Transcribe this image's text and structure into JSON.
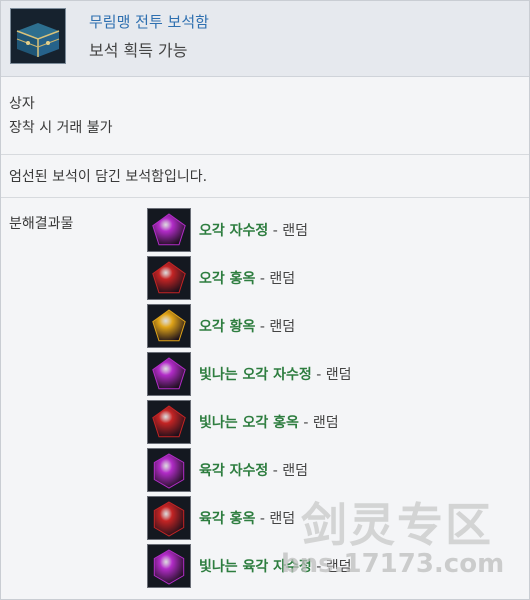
{
  "header": {
    "title": "무림맹 전투 보석함",
    "subtitle": "보석 획득 가능"
  },
  "info": {
    "type": "상자",
    "trade": "장착 시 거래 불가"
  },
  "description": "엄선된 보석이 담긴 보석함입니다.",
  "decomposition": {
    "label": "분해결과물",
    "separator": "-",
    "random_label": "랜덤",
    "items": [
      {
        "name": "오각 자수정",
        "color": "#b22cc8",
        "shape": "pentagon"
      },
      {
        "name": "오각 홍옥",
        "color": "#c42424",
        "shape": "pentagon"
      },
      {
        "name": "오각 황옥",
        "color": "#e0a418",
        "shape": "pentagon"
      },
      {
        "name": "빛나는 오각 자수정",
        "color": "#b22cc8",
        "shape": "pentagon"
      },
      {
        "name": "빛나는 오각 홍옥",
        "color": "#c42424",
        "shape": "pentagon"
      },
      {
        "name": "육각 자수정",
        "color": "#b22cc8",
        "shape": "hexagon"
      },
      {
        "name": "육각 홍옥",
        "color": "#c42424",
        "shape": "hexagon"
      },
      {
        "name": "빛나는 육각 자수정",
        "color": "#b22cc8",
        "shape": "hexagon"
      }
    ]
  },
  "watermark": {
    "logo_text": "剑灵专区",
    "url_text": "bns.17173.com"
  },
  "colors": {
    "title": "#2f70b0",
    "gem_name": "#2d7d3f",
    "header_bg": "#e6e9ee",
    "panel_bg": "#f4f5f7"
  }
}
